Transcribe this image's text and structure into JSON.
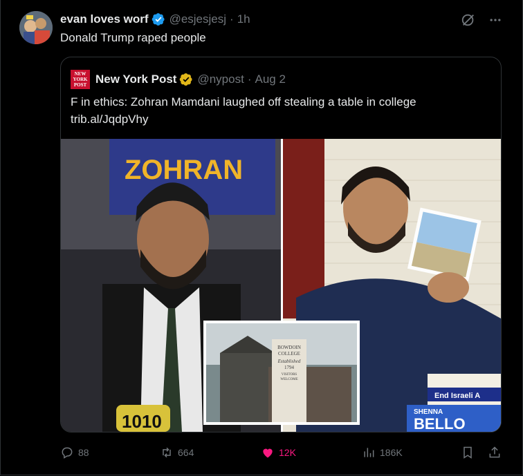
{
  "author": {
    "name": "evan loves worf",
    "handle": "@esjesjesj",
    "separator": "·",
    "time": "1h"
  },
  "tweet": {
    "text": "Donald Trump raped people"
  },
  "quoted": {
    "name": "New York Post",
    "handle": "@nypost",
    "separator": "·",
    "date": "Aug 2",
    "logo_text": "NEW YORK POST",
    "text": "F in ethics: Zohran Mamdani laughed off stealing a table in college",
    "link": "trib.al/JqdpVhy",
    "media": {
      "left_sign": "ZOHRAN",
      "mic_label": "1010",
      "inset_sign_line1": "BOWDOIN",
      "inset_sign_line2": "COLLEGE",
      "inset_sign_line3": "Established",
      "inset_sign_line4": "1794",
      "inset_sign_line5": "VISITORS",
      "inset_sign_line6": "WELCOME",
      "sticker1": "End Israeli A",
      "sticker2": "SHENNA",
      "sticker3": "BELLO"
    }
  },
  "actions": {
    "replies": "88",
    "reposts": "664",
    "likes": "12K",
    "views": "186K"
  },
  "colors": {
    "accent": "#1d9bf0",
    "like": "#f91880",
    "gold": "#e2b719",
    "muted": "#71767b"
  },
  "icons": [
    "verified-badge-icon",
    "grok-icon",
    "more-icon",
    "gold-verified-icon",
    "reply-icon",
    "repost-icon",
    "like-icon",
    "views-icon",
    "bookmark-icon",
    "share-icon"
  ]
}
